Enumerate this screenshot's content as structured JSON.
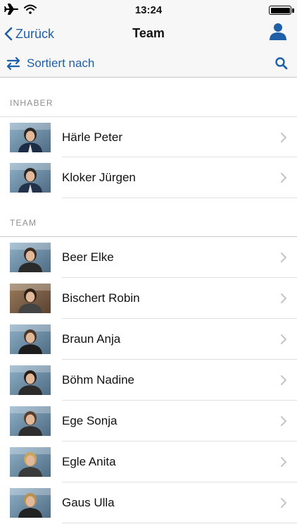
{
  "status_bar": {
    "time": "13:24",
    "icons": [
      "airplane-icon",
      "wifi-icon",
      "battery-icon"
    ]
  },
  "nav": {
    "back_label": "Zurück",
    "title": "Team",
    "profile_icon": "person-icon"
  },
  "toolbar": {
    "sort_label": "Sortiert nach",
    "sort_icon": "swap-arrows-icon",
    "search_icon": "search-icon"
  },
  "colors": {
    "accent": "#1f5fa8",
    "section_text": "#8e8e93",
    "bar_bg": "#f7f7f8"
  },
  "sections": [
    {
      "title": "INHABER",
      "members": [
        {
          "name": "Härle Peter"
        },
        {
          "name": "Kloker Jürgen"
        }
      ]
    },
    {
      "title": "TEAM",
      "members": [
        {
          "name": "Beer Elke"
        },
        {
          "name": "Bischert Robin"
        },
        {
          "name": "Braun Anja"
        },
        {
          "name": "Böhm Nadine"
        },
        {
          "name": "Ege Sonja"
        },
        {
          "name": "Egle Anita"
        },
        {
          "name": "Gaus Ulla"
        }
      ]
    }
  ]
}
